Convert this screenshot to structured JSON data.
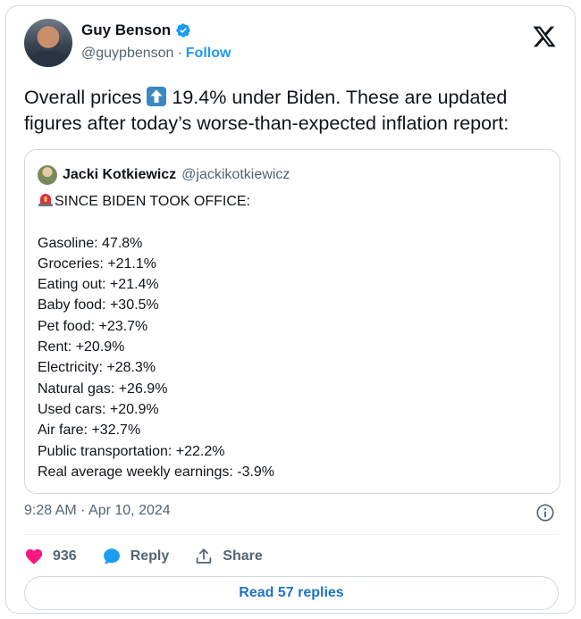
{
  "author": {
    "name": "Guy Benson",
    "handle": "@guypbenson",
    "separator": "·",
    "follow_label": "Follow"
  },
  "tweet": {
    "text_before": "Overall prices ",
    "emoji": "up-arrow-emoji",
    "text_after": " 19.4% under Biden. These are updated figures after today’s worse-than-expected inflation report:"
  },
  "quote": {
    "name": "Jacki Kotkiewicz",
    "handle": "@jackikotkiewicz",
    "heading": "SINCE BIDEN TOOK OFFICE:",
    "items": [
      "Gasoline: 47.8%",
      "Groceries: +21.1%",
      "Eating out: +21.4%",
      "Baby food: +30.5%",
      "Pet food: +23.7%",
      "Rent: +20.9%",
      "Electricity: +28.3%",
      "Natural gas: +26.9%",
      "Used cars: +20.9%",
      "Air fare: +32.7%",
      "Public transportation: +22.2%",
      "Real average weekly earnings: -3.9%"
    ]
  },
  "timestamp": "9:28 AM · Apr 10, 2024",
  "actions": {
    "likes": "936",
    "reply_label": "Reply",
    "share_label": "Share"
  },
  "read_replies_label": "Read 57 replies",
  "colors": {
    "accent": "#1d9bf0",
    "like": "#f91880",
    "muted": "#536471",
    "border": "#cfd9de"
  }
}
